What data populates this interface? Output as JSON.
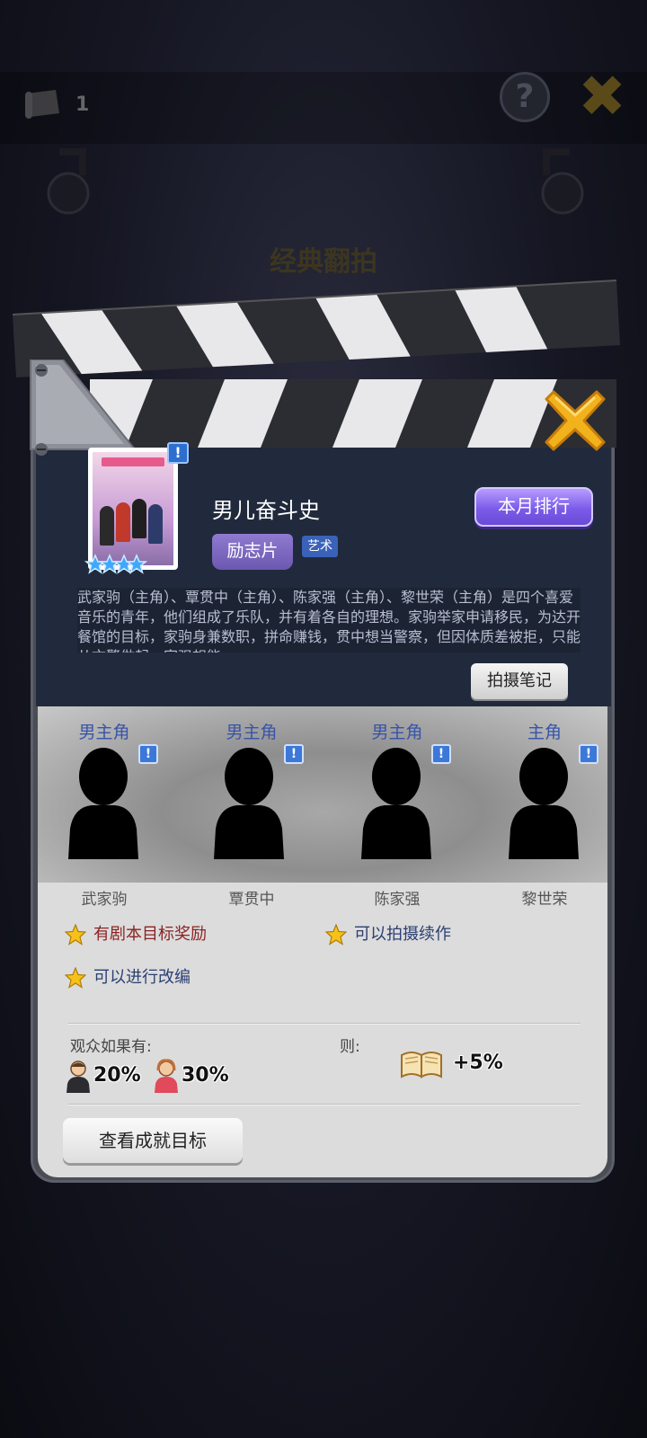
{
  "background": {
    "count": "1",
    "help_label": "?",
    "title": "经典翻拍"
  },
  "movie": {
    "title": "男儿奋斗史",
    "genre": "励志片",
    "tag": "艺术",
    "rank_button": "本月排行",
    "synopsis": "武家驹（主角）、覃贯中（主角）、陈家强（主角）、黎世荣（主角）是四个喜爱音乐的青年，他们组成了乐队，并有着各自的理想。家驹举家申请移民，为达开餐馆的目标，家驹身兼数职，拼命赚钱，贯中想当警察，但因体质差被拒，只能从文警做起，家强想能",
    "notes_button": "拍摄笔记",
    "badge": "!"
  },
  "cast": [
    {
      "role": "男主角",
      "name": "武家驹"
    },
    {
      "role": "男主角",
      "name": "覃贯中"
    },
    {
      "role": "男主角",
      "name": "陈家强"
    },
    {
      "role": "主角",
      "name": "黎世荣"
    }
  ],
  "features": [
    {
      "label": "有剧本目标奖励",
      "color": "#8b2323"
    },
    {
      "label": "可以拍摄续作",
      "color": "#2c3f72"
    },
    {
      "label": "可以进行改编",
      "color": "#2c3f72"
    }
  ],
  "audience": {
    "label": "观众如果有:",
    "male": "20%",
    "female": "30%",
    "then_label": "则:",
    "bonus": "+5%"
  },
  "achievements_button": "查看成就目标",
  "colors": {
    "panel_dark": "#202a3c",
    "panel_light": "#dcdcdc",
    "rank_button": "#7b5ce8",
    "close_icon": "#f2b21b"
  }
}
